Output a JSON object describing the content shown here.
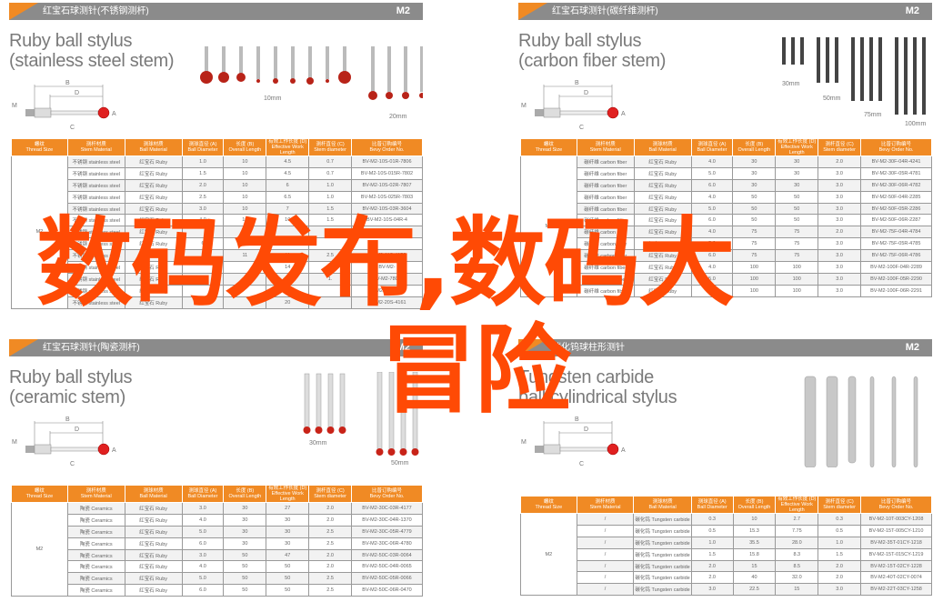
{
  "headers": [
    "螺纹\nThread Size",
    "测杆材质\nStem Material",
    "测球材质\nBall Material",
    "测球直径 (A)\nBall Diameter",
    "长度 (B)\nOverall Length",
    "有效工作长度 (D)\nEffective Work Length",
    "测杆直径 (C)\nStem diameter",
    "比普订购编号\nBevy Order No."
  ],
  "diagram_labels": {
    "b": "B",
    "d": "D",
    "m": "M",
    "a": "A",
    "c": "C"
  },
  "colors": {
    "accent": "#f08a24",
    "header_bar": "#8b8b8b",
    "overlay": "#ff4a05",
    "ruby": "#c0281e"
  },
  "panels": [
    {
      "category": "红宝石球测针(不锈钢测杆)",
      "size": "M2",
      "title1": "Ruby ball stylus",
      "title2": "(stainless steel stem)",
      "captions": [
        "10mm",
        "20mm"
      ],
      "thread": "M2",
      "rows": [
        [
          "不锈钢 stainless steel",
          "红宝石 Ruby",
          "1.0",
          "10",
          "4.5",
          "0.7",
          "BV-M2-10S-01R-7806"
        ],
        [
          "不锈钢 stainless steel",
          "红宝石 Ruby",
          "1.5",
          "10",
          "4.5",
          "0.7",
          "BV-M2-10S-015R-7802"
        ],
        [
          "不锈钢 stainless steel",
          "红宝石 Ruby",
          "2.0",
          "10",
          "6",
          "1.0",
          "BV-M2-10S-02R-7807"
        ],
        [
          "不锈钢 stainless steel",
          "红宝石 Ruby",
          "2.5",
          "10",
          "6.5",
          "1.0",
          "BV-M2-10S-025R-7803"
        ],
        [
          "不锈钢 stainless steel",
          "红宝石 Ruby",
          "3.0",
          "10",
          "7",
          "1.5",
          "BV-M2-10S-03R-3604"
        ],
        [
          "不锈钢 stainless steel",
          "红宝石 Ruby",
          "4.0",
          "10",
          "10",
          "1.5",
          "BV-M2-10S-04R-4"
        ],
        [
          "不锈钢 stainless steel",
          "红宝石 Ruby",
          "",
          "10",
          "",
          "2.5",
          "BV-M2-10S-05R"
        ],
        [
          "不锈钢 stainless steel",
          "红宝石 Ruby",
          "6",
          "10",
          "",
          "",
          ""
        ],
        [
          "不锈钢 stainless steel",
          "红宝石 Ruby",
          "",
          "11",
          "11",
          "2.5",
          "BV-M2-11S-4158"
        ],
        [
          "不锈钢 stainless steel",
          "红宝石 Ruby",
          "",
          "",
          "14",
          "",
          "BV-M2-"
        ],
        [
          "不锈钢 stainless steel",
          "红宝石 Ruby",
          "2.5",
          "",
          "",
          "1.",
          "BV-M2-7804"
        ],
        [
          "不锈钢 stainless steel",
          "红宝石 Ruby",
          "",
          "",
          "",
          "",
          "BV-M2-20S-4160"
        ],
        [
          "不锈钢 stainless steel",
          "红宝石 Ruby",
          "4.0",
          "",
          "20",
          "",
          "BV-M2-20S-4161"
        ]
      ]
    },
    {
      "category": "红宝石球测针(碳纤维测杆)",
      "size": "M2",
      "title1": "Ruby ball stylus",
      "title2": "(carbon fiber stem)",
      "captions": [
        "30mm",
        "50mm",
        "75mm",
        "100mm"
      ],
      "thread": "M2",
      "rows": [
        [
          "碳纤维 carbon fiber",
          "红宝石 Ruby",
          "4.0",
          "30",
          "30",
          "2.0",
          "BV-M2-30F-04R-4241"
        ],
        [
          "碳纤维 carbon fiber",
          "红宝石 Ruby",
          "5.0",
          "30",
          "30",
          "3.0",
          "BV-M2-30F-05R-4781"
        ],
        [
          "碳纤维 carbon fiber",
          "红宝石 Ruby",
          "6.0",
          "30",
          "30",
          "3.0",
          "BV-M2-30F-06R-4782"
        ],
        [
          "碳纤维 carbon fiber",
          "红宝石 Ruby",
          "4.0",
          "50",
          "50",
          "3.0",
          "BV-M2-50F-04R-2285"
        ],
        [
          "碳纤维 carbon fiber",
          "红宝石 Ruby",
          "5.0",
          "50",
          "50",
          "3.0",
          "BV-M2-50F-05R-2286"
        ],
        [
          "碳纤维 carbon fiber",
          "红宝石 Ruby",
          "6.0",
          "50",
          "50",
          "3.0",
          "BV-M2-50F-06R-2287"
        ],
        [
          "碳纤维 carbon fiber",
          "红宝石 Ruby",
          "4.0",
          "75",
          "75",
          "2.0",
          "BV-M2-75F-04R-4784"
        ],
        [
          "碳纤维 carbon fiber",
          "红宝石 Ruby",
          "5.0",
          "75",
          "75",
          "3.0",
          "BV-M2-75F-05R-4785"
        ],
        [
          "碳纤维 carbon fiber",
          "红宝石 Ruby",
          "6.0",
          "75",
          "75",
          "3.0",
          "BV-M2-75F-06R-4786"
        ],
        [
          "碳纤维 carbon fiber",
          "红宝石 Ruby",
          "4.0",
          "100",
          "100",
          "3.0",
          "BV-M2-100F-04R-2289"
        ],
        [
          "碳纤维 carbon fiber",
          "红宝石 Ruby",
          "5.0",
          "100",
          "100",
          "3.0",
          "BV-M2-100F-05R-2290"
        ],
        [
          "碳纤维 carbon fiber",
          "红宝石 Ruby",
          "6.0",
          "100",
          "100",
          "3.0",
          "BV-M2-100F-06R-2291"
        ]
      ]
    },
    {
      "category": "红宝石球测针(陶瓷测杆)",
      "size": "M2",
      "title1": "Ruby ball stylus",
      "title2": "(ceramic stem)",
      "captions": [
        "30mm",
        "50mm"
      ],
      "thread": "M2",
      "rows": [
        [
          "陶瓷 Ceramics",
          "红宝石 Ruby",
          "3.0",
          "30",
          "27",
          "2.0",
          "BV-M2-30C-03R-4177"
        ],
        [
          "陶瓷 Ceramics",
          "红宝石 Ruby",
          "4.0",
          "30",
          "30",
          "2.0",
          "BV-M2-30C-04R-1370"
        ],
        [
          "陶瓷 Ceramics",
          "红宝石 Ruby",
          "5.0",
          "30",
          "30",
          "2.5",
          "BV-M2-30C-05R-4779"
        ],
        [
          "陶瓷 Ceramics",
          "红宝石 Ruby",
          "6.0",
          "30",
          "30",
          "2.5",
          "BV-M2-30C-06R-4780"
        ],
        [
          "陶瓷 Ceramics",
          "红宝石 Ruby",
          "3.0",
          "50",
          "47",
          "2.0",
          "BV-M2-50C-03R-0064"
        ],
        [
          "陶瓷 Ceramics",
          "红宝石 Ruby",
          "4.0",
          "50",
          "50",
          "2.0",
          "BV-M2-50C-04R-0065"
        ],
        [
          "陶瓷 Ceramics",
          "红宝石 Ruby",
          "5.0",
          "50",
          "50",
          "2.5",
          "BV-M2-50C-05R-0066"
        ],
        [
          "陶瓷 Ceramics",
          "红宝石 Ruby",
          "6.0",
          "50",
          "50",
          "2.5",
          "BV-M2-50C-06R-0470"
        ]
      ]
    },
    {
      "category": "碳化钨球柱形测针",
      "size": "M2",
      "title1": "Tungsten carbide",
      "title2": "ball cylindrical stylus",
      "captions": [],
      "thread": "M2",
      "rows": [
        [
          "/",
          "碳化钨 Tungsten carbide",
          "0.3",
          "10",
          "2.7",
          "0.3",
          "BV-M2-10T-003CY-1208"
        ],
        [
          "/",
          "碳化钨 Tungsten carbide",
          "0.5",
          "15.3",
          "7.75",
          "0.5",
          "BV-M2-15T-005CY-1210"
        ],
        [
          "/",
          "碳化钨 Tungsten carbide",
          "1.0",
          "35.5",
          "28.0",
          "1.0",
          "BV-M2-35T-01CY-1218"
        ],
        [
          "/",
          "碳化钨 Tungsten carbide",
          "1.5",
          "15.8",
          "8.3",
          "1.5",
          "BV-M2-15T-015CY-1219"
        ],
        [
          "/",
          "碳化钨 Tungsten carbide",
          "2.0",
          "15",
          "8.5",
          "2.0",
          "BV-M2-15T-02CY-1228"
        ],
        [
          "/",
          "碳化钨 Tungsten carbide",
          "2.0",
          "40",
          "32.0",
          "2.0",
          "BV-M2-40T-02CY-0074"
        ],
        [
          "/",
          "碳化钨 Tungsten carbide",
          "3.0",
          "22.5",
          "15",
          "3.0",
          "BV-M2-22T-03CY-1258"
        ]
      ]
    }
  ],
  "overlay": {
    "line1": "数码发布,数码大",
    "line2": "冒险"
  }
}
